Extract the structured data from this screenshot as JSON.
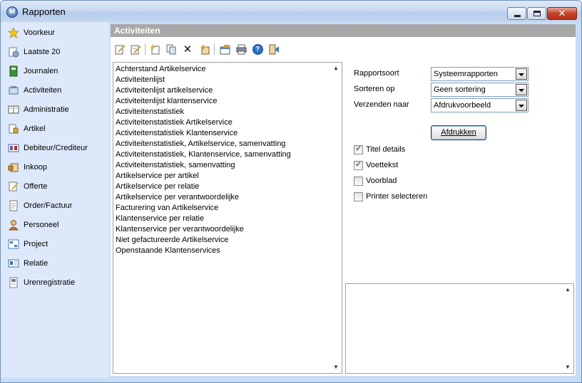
{
  "window": {
    "title": "Rapporten",
    "icon": "app-logo-icon",
    "close_glyph": "✕"
  },
  "sidebar": {
    "items": [
      {
        "label": "Voorkeur",
        "icon": "star-icon",
        "color": "#f2c81c"
      },
      {
        "label": "Laatste 20",
        "icon": "recent-docs-icon",
        "color": "#8aa6c8"
      },
      {
        "label": "Journalen",
        "icon": "journal-icon",
        "color": "#3d8f3d"
      },
      {
        "label": "Activiteiten",
        "icon": "activities-icon",
        "color": "#6f8fb3"
      },
      {
        "label": "Administratie",
        "icon": "book-icon",
        "color": "#6a6a6a"
      },
      {
        "label": "Artikel",
        "icon": "article-icon",
        "color": "#c9a74a"
      },
      {
        "label": "Debiteur/Crediteur",
        "icon": "ledger-icon",
        "color": "#5d5d9a"
      },
      {
        "label": "Inkoop",
        "icon": "purchase-icon",
        "color": "#c98a2b"
      },
      {
        "label": "Offerte",
        "icon": "quote-icon",
        "color": "#d4a640"
      },
      {
        "label": "Order/Factuur",
        "icon": "invoice-icon",
        "color": "#8a8a8a"
      },
      {
        "label": "Personeel",
        "icon": "person-icon",
        "color": "#c07a3a"
      },
      {
        "label": "Project",
        "icon": "project-icon",
        "color": "#4c7ab5"
      },
      {
        "label": "Relatie",
        "icon": "contact-card-icon",
        "color": "#3f6fb0"
      },
      {
        "label": "Urenregistratie",
        "icon": "timesheet-icon",
        "color": "#7a7a9a"
      }
    ]
  },
  "panel": {
    "title": "Activiteiten"
  },
  "toolbar": {
    "buttons": [
      {
        "icon": "edit-icon",
        "color": "#c7a64a"
      },
      {
        "icon": "edit-properties-icon",
        "color": "#c7a64a"
      },
      {
        "icon": "new-report-icon",
        "color": "#e0b838"
      },
      {
        "icon": "copy-icon",
        "color": "#8aa0be"
      },
      {
        "icon": "delete-icon",
        "color": "#111111"
      },
      {
        "icon": "import-icon",
        "color": "#d89a2a"
      },
      {
        "icon": "settings-icon",
        "color": "#5f86b8"
      },
      {
        "icon": "print-icon",
        "color": "#7f8fa8"
      },
      {
        "icon": "help-icon",
        "color": "#2e6fc2"
      },
      {
        "icon": "exit-icon",
        "color": "#3a78c8"
      }
    ],
    "delete_glyph": "✕",
    "help_glyph": "?"
  },
  "reports": {
    "items": [
      "Achterstand Artikelservice",
      "Activiteitenlijst",
      "Activiteitenlijst artikelservice",
      "Activiteitenlijst klantenservice",
      "Activiteitenstatistiek",
      "Activiteitenstatistiek Artikelservice",
      "Activiteitenstatistiek Klantenservice",
      "Activiteitenstatistiek, Artikelservice, samenvatting",
      "Activiteitenstatistiek, Klantenservice, samenvatting",
      "Activiteitenstatistiek, samenvatting",
      "Artikelservice per artikel",
      "Artikelservice per relatie",
      "Artikelservice per verantwoordelijke",
      "Facturering van Artikelservice",
      "Klantenservice per relatie",
      "Klantenservice per verantwoordelijke",
      "Niet gefactureerde Artikelservice",
      "Openstaande Klantenservices"
    ],
    "scroll_up_glyph": "▲",
    "scroll_down_glyph": "▼"
  },
  "settings": {
    "rapportsoort": {
      "label": "Rapportsoort",
      "value": "Systeemrapporten"
    },
    "sorteren": {
      "label": "Sorteren op",
      "value": "Geen sortering"
    },
    "verzenden": {
      "label": "Verzenden naar",
      "value": "Afdrukvoorbeeld"
    },
    "print_button": "Afdrukken",
    "options": [
      {
        "label": "Titel details",
        "checked": true
      },
      {
        "label": "Voettekst",
        "checked": true
      },
      {
        "label": "Voorblad",
        "checked": false
      },
      {
        "label": "Printer selecteren",
        "checked": false
      }
    ],
    "check_glyph": "✓"
  },
  "memo": {
    "scroll_up_glyph": "▲",
    "scroll_down_glyph": "▼"
  }
}
